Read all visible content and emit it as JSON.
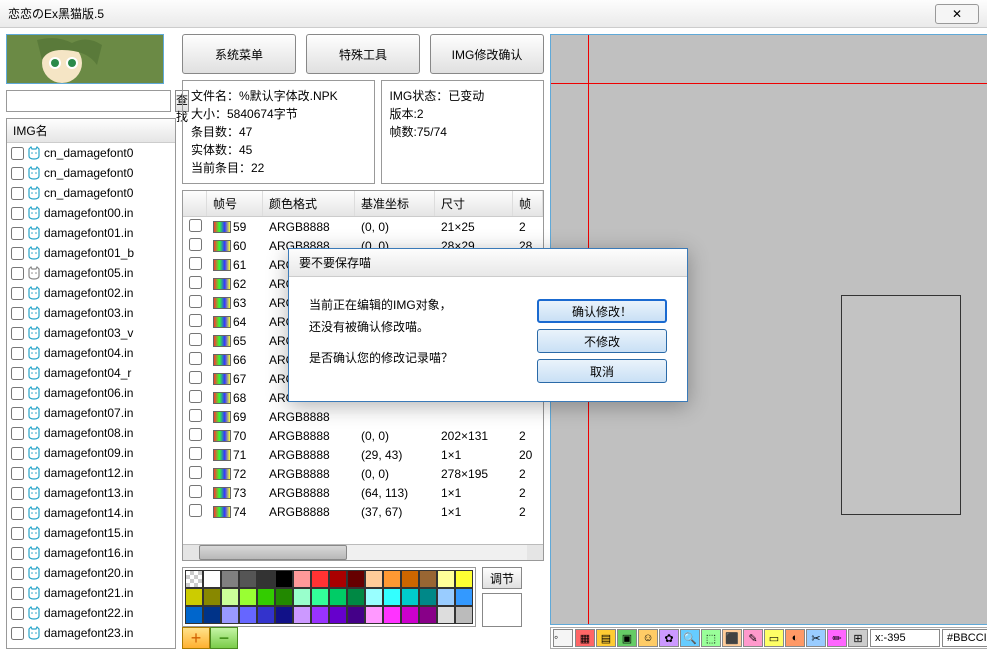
{
  "window": {
    "title": "恋恋のEx黑猫版.5",
    "close": "✕"
  },
  "buttons": {
    "system_menu": "系统菜单",
    "special_tools": "特殊工具",
    "img_confirm": "IMG修改确认",
    "search": "查找",
    "adjust": "调节"
  },
  "search": {
    "placeholder": ""
  },
  "imglist_header": "IMG名",
  "imglist": [
    "cn_damagefont0",
    "cn_damagefont0",
    "cn_damagefont0",
    "damagefont00.in",
    "damagefont01.in",
    "damagefont01_b",
    "damagefont05.in",
    "damagefont02.in",
    "damagefont03.in",
    "damagefont03_v",
    "damagefont04.in",
    "damagefont04_r",
    "damagefont06.in",
    "damagefont07.in",
    "damagefont08.in",
    "damagefont09.in",
    "damagefont12.in",
    "damagefont13.in",
    "damagefont14.in",
    "damagefont15.in",
    "damagefont16.in",
    "damagefont20.in",
    "damagefont21.in",
    "damagefont22.in",
    "damagefont23.in"
  ],
  "gray_index": 6,
  "info_left": {
    "l1": "文件名：%默认字体改.NPK",
    "l2": "大小：5840674字节",
    "l3": "条目数：47",
    "l4": "实体数：45",
    "l5": "当前条目：22"
  },
  "info_right": {
    "l1": "IMG状态：已变动",
    "l2": "版本:2",
    "l3": "帧数:75/74"
  },
  "frame_headers": {
    "num": "帧号",
    "fmt": "颜色格式",
    "coord": "基准坐标",
    "size": "尺寸",
    "last": "帧"
  },
  "frames": [
    {
      "n": "59",
      "fmt": "ARGB8888",
      "c": "(0, 0)",
      "s": "21×25",
      "x": "2"
    },
    {
      "n": "60",
      "fmt": "ARGB8888",
      "c": "(0, 0)",
      "s": "28×29",
      "x": "28"
    },
    {
      "n": "61",
      "fmt": "ARGB8888",
      "c": "",
      "s": "",
      "x": ""
    },
    {
      "n": "62",
      "fmt": "ARGB8888",
      "c": "",
      "s": "",
      "x": ""
    },
    {
      "n": "63",
      "fmt": "ARGB8888",
      "c": "",
      "s": "",
      "x": ""
    },
    {
      "n": "64",
      "fmt": "ARGB8888",
      "c": "",
      "s": "",
      "x": ""
    },
    {
      "n": "65",
      "fmt": "ARGB8888",
      "c": "",
      "s": "",
      "x": ""
    },
    {
      "n": "66",
      "fmt": "ARGB8888",
      "c": "",
      "s": "",
      "x": ""
    },
    {
      "n": "67",
      "fmt": "ARGB8888",
      "c": "",
      "s": "",
      "x": ""
    },
    {
      "n": "68",
      "fmt": "ARGB8888",
      "c": "",
      "s": "",
      "x": ""
    },
    {
      "n": "69",
      "fmt": "ARGB8888",
      "c": "",
      "s": "",
      "x": ""
    },
    {
      "n": "70",
      "fmt": "ARGB8888",
      "c": "(0, 0)",
      "s": "202×131",
      "x": "2"
    },
    {
      "n": "71",
      "fmt": "ARGB8888",
      "c": "(29, 43)",
      "s": "1×1",
      "x": "20"
    },
    {
      "n": "72",
      "fmt": "ARGB8888",
      "c": "(0, 0)",
      "s": "278×195",
      "x": "2"
    },
    {
      "n": "73",
      "fmt": "ARGB8888",
      "c": "(64, 113)",
      "s": "1×1",
      "x": "2"
    },
    {
      "n": "74",
      "fmt": "ARGB8888",
      "c": "(37, 67)",
      "s": "1×1",
      "x": "2"
    }
  ],
  "palette": [
    "url(data:image/svg+xml;utf8,<svg xmlns='http://www.w3.org/2000/svg' width='6' height='6'><rect width='3' height='3' fill='%23ccc'/><rect x='3' y='3' width='3' height='3' fill='%23ccc'/></svg>)",
    "#ffffff",
    "#808080",
    "#555555",
    "#333333",
    "#000000",
    "#ff9999",
    "#ff3333",
    "#aa0000",
    "#660000",
    "#ffcc99",
    "#ff9933",
    "#cc6600",
    "#996633",
    "#ffff99",
    "#ffff33",
    "#cccc00",
    "#888800",
    "#ccff99",
    "#99ff33",
    "#33cc00",
    "#228800",
    "#99ffcc",
    "#33ff99",
    "#00cc66",
    "#008844",
    "#99ffff",
    "#33ffff",
    "#00cccc",
    "#008888",
    "#99ccff",
    "#3399ff",
    "#0066cc",
    "#003388",
    "#9999ff",
    "#6666ff",
    "#3333cc",
    "#111188",
    "#cc99ff",
    "#9933ff",
    "#6600cc",
    "#440088",
    "#ff99ff",
    "#ff33ff",
    "#cc00cc",
    "#880088",
    "#dddddd",
    "#bbbbbb"
  ],
  "dialog": {
    "title": "要不要保存喵",
    "line1": "当前正在编辑的IMG对象，",
    "line2": "还没有被确认修改喵。",
    "line3": "是否确认您的修改记录喵？",
    "btn_confirm": "确认修改！",
    "btn_no": "不修改",
    "btn_cancel": "取消"
  },
  "status": {
    "coord": "x:-395",
    "hex": "#BBCCI"
  },
  "tool_colors": [
    "#ff6666",
    "#ffcc33",
    "#66cc66",
    "#ffcc66",
    "#cc99ff",
    "#66ccff",
    "#99ff99",
    "#ffcc99",
    "#ff99cc",
    "#ffff66",
    "#ff9966",
    "#99ccff",
    "#ff66ff",
    "#cccccc"
  ]
}
